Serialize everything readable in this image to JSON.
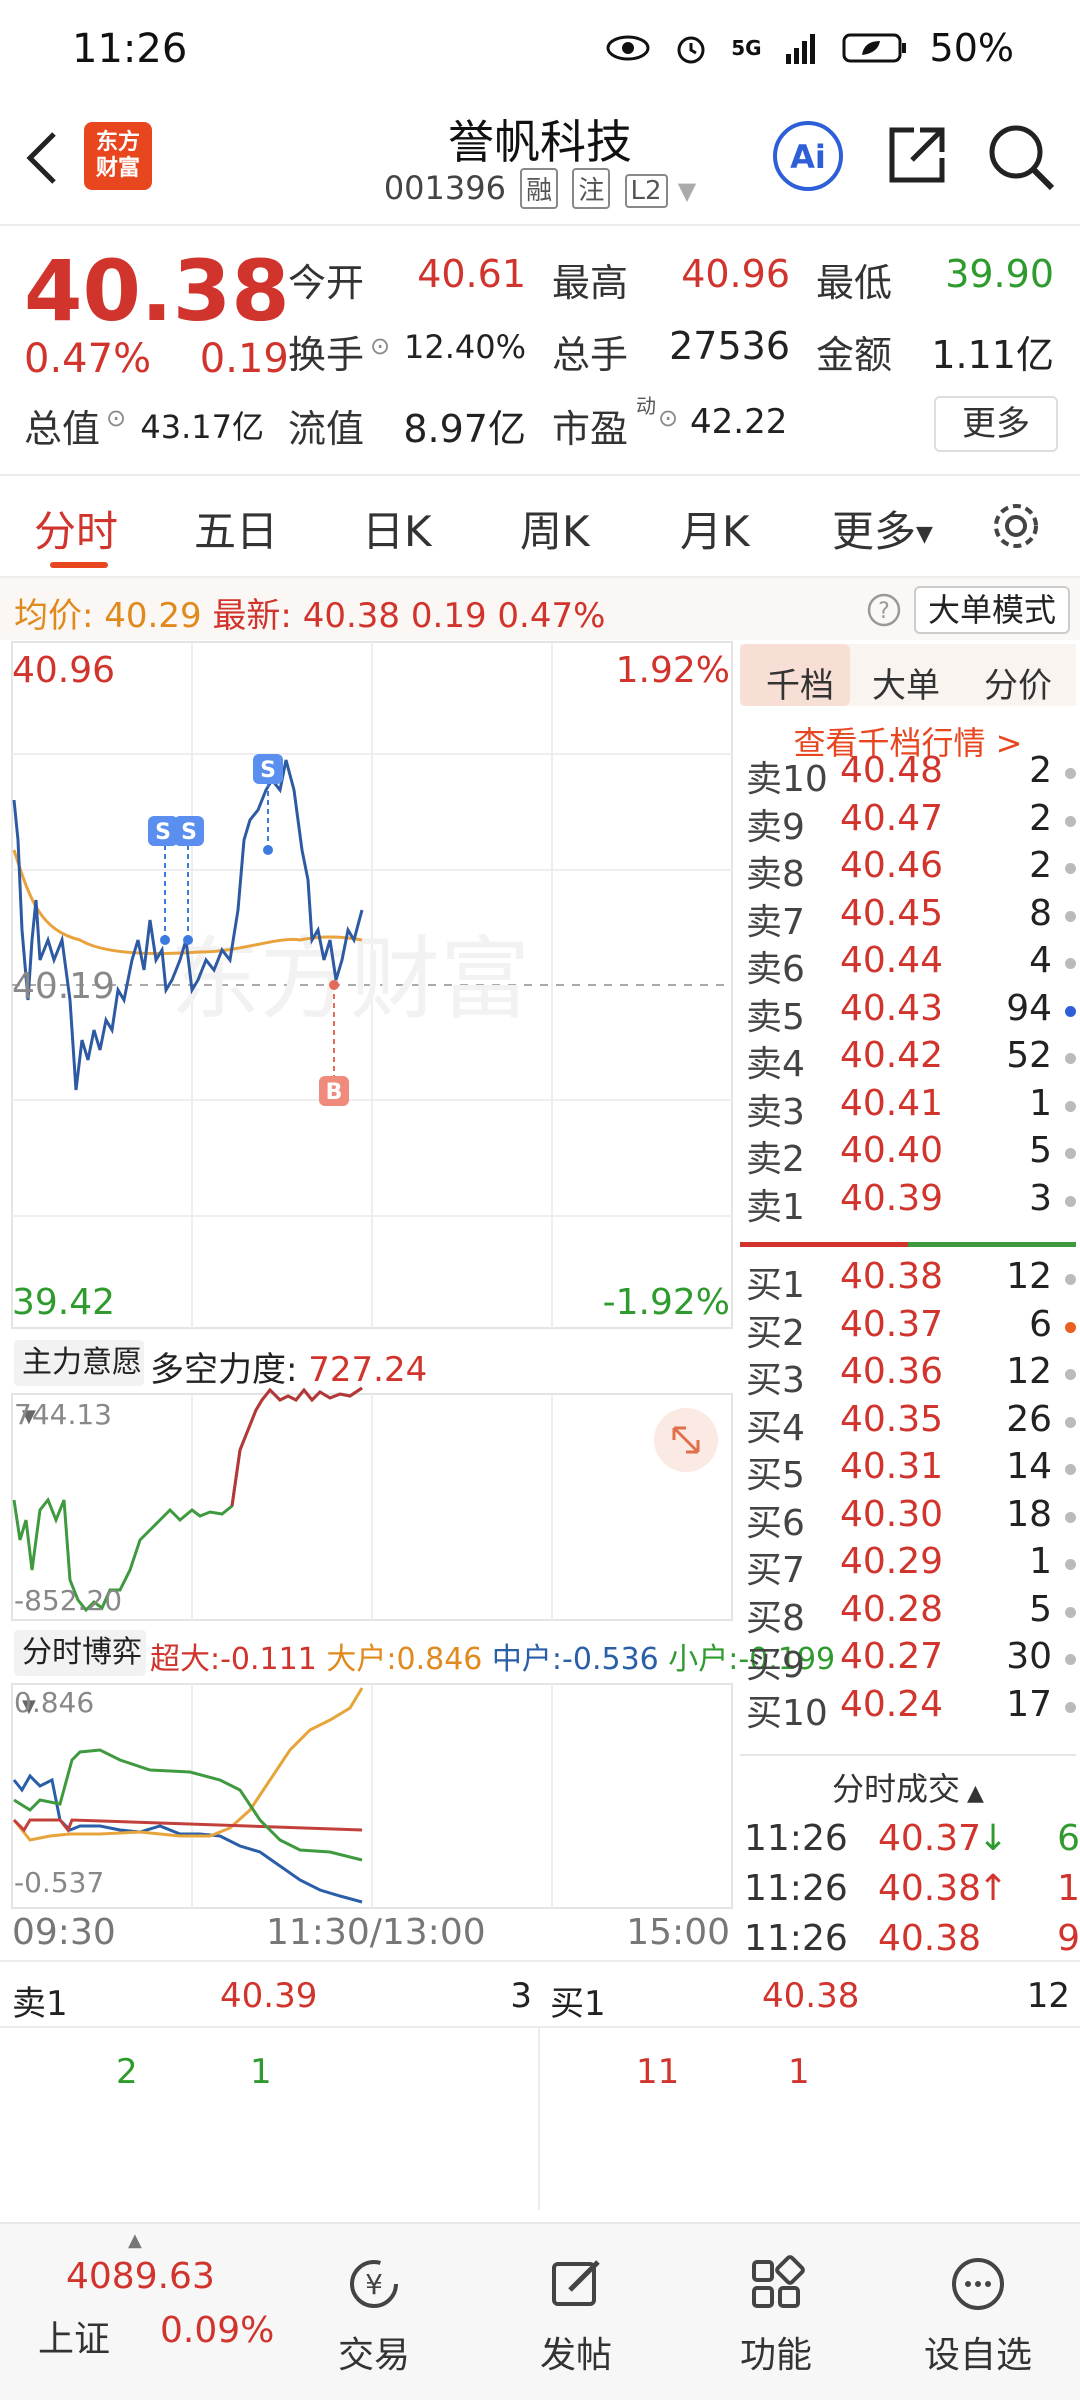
{
  "status_bar": {
    "time": "11:26",
    "network": "5G",
    "battery": "50%"
  },
  "header": {
    "logo_line1": "东方",
    "logo_line2": "财富",
    "name": "誉帆科技",
    "code": "001396",
    "tags": [
      "融",
      "注",
      "L2"
    ]
  },
  "quote": {
    "price": "40.38",
    "pct": "0.47%",
    "chg": "0.19",
    "fields": [
      {
        "label": "今开",
        "value": "40.61",
        "color": "red"
      },
      {
        "label": "最高",
        "value": "40.96",
        "color": "red"
      },
      {
        "label": "最低",
        "value": "39.90",
        "color": "green"
      },
      {
        "label": "换手",
        "value": "12.40%",
        "color": "dark"
      },
      {
        "label": "总手",
        "value": "27536",
        "color": "dark"
      },
      {
        "label": "金额",
        "value": "1.11亿",
        "color": "dark"
      },
      {
        "label": "总值",
        "value": "43.17亿",
        "color": "dark"
      },
      {
        "label": "流值",
        "value": "8.97亿",
        "color": "dark"
      },
      {
        "label": "市盈",
        "value": "42.22",
        "color": "dark"
      }
    ],
    "pe_superscript": "动",
    "more_button": "更多"
  },
  "tabs": [
    "分时",
    "五日",
    "日K",
    "周K",
    "月K",
    "更多"
  ],
  "avg_bar": {
    "avg_label": "均价:",
    "avg_value": "40.29",
    "last_label": "最新:",
    "last_value": "40.38",
    "last_chg": "0.19",
    "last_pct": "0.47%",
    "big_order_button": "大单模式"
  },
  "main_chart": {
    "high": "40.96",
    "high_pct": "1.92%",
    "low": "39.42",
    "low_pct": "-1.92%",
    "prev_close": "40.19",
    "markers": [
      "S",
      "S",
      "S",
      "B"
    ]
  },
  "chart_data": [
    {
      "type": "line",
      "x": [
        "09:30",
        "11:30/13:00",
        "15:00"
      ],
      "ylim": [
        39.42,
        40.96
      ],
      "series": []
    },
    {
      "type": "line",
      "ylim": [
        -852.2,
        744.13
      ],
      "series": []
    },
    {
      "type": "line",
      "ylim": [
        -0.537,
        0.846
      ],
      "series": [
        {
          "name": "超大",
          "values": [
            -0.111
          ]
        },
        {
          "name": "大户",
          "values": [
            0.846
          ]
        },
        {
          "name": "中户",
          "values": [
            -0.536
          ]
        },
        {
          "name": "小户",
          "values": [
            -0.199
          ]
        }
      ]
    }
  ],
  "indicator1": {
    "selector": "主力意愿",
    "title": "多空力度:",
    "value": "727.24",
    "top": "744.13",
    "bottom": "-852.20"
  },
  "indicator2": {
    "selector": "分时博弈",
    "items": [
      {
        "label": "超大:",
        "value": "-0.111",
        "color": "#d0342c"
      },
      {
        "label": "大户:",
        "value": "0.846",
        "color": "#e08a1d"
      },
      {
        "label": "中户:",
        "value": "-0.536",
        "color": "#2a5fa8"
      },
      {
        "label": "小户:",
        "value": "-0.199",
        "color": "#2f9b2f"
      }
    ],
    "top": "0.846",
    "bottom": "-0.537"
  },
  "time_axis": [
    "09:30",
    "11:30/13:00",
    "15:00"
  ],
  "book": {
    "tabs": [
      "千档",
      "大单",
      "分价"
    ],
    "link": "查看千档行情 >",
    "asks": [
      {
        "side": "卖10",
        "price": "40.48",
        "vol": "2"
      },
      {
        "side": "卖9",
        "price": "40.47",
        "vol": "2"
      },
      {
        "side": "卖8",
        "price": "40.46",
        "vol": "2"
      },
      {
        "side": "卖7",
        "price": "40.45",
        "vol": "8"
      },
      {
        "side": "卖6",
        "price": "40.44",
        "vol": "4"
      },
      {
        "side": "卖5",
        "price": "40.43",
        "vol": "94"
      },
      {
        "side": "卖4",
        "price": "40.42",
        "vol": "52"
      },
      {
        "side": "卖3",
        "price": "40.41",
        "vol": "1"
      },
      {
        "side": "卖2",
        "price": "40.40",
        "vol": "5"
      },
      {
        "side": "卖1",
        "price": "40.39",
        "vol": "3"
      }
    ],
    "bids": [
      {
        "side": "买1",
        "price": "40.38",
        "vol": "12"
      },
      {
        "side": "买2",
        "price": "40.37",
        "vol": "6"
      },
      {
        "side": "买3",
        "price": "40.36",
        "vol": "12"
      },
      {
        "side": "买4",
        "price": "40.35",
        "vol": "26"
      },
      {
        "side": "买5",
        "price": "40.31",
        "vol": "14"
      },
      {
        "side": "买6",
        "price": "40.30",
        "vol": "18"
      },
      {
        "side": "买7",
        "price": "40.29",
        "vol": "1"
      },
      {
        "side": "买8",
        "price": "40.28",
        "vol": "5"
      },
      {
        "side": "买9",
        "price": "40.27",
        "vol": "30"
      },
      {
        "side": "买10",
        "price": "40.24",
        "vol": "17"
      }
    ],
    "tick_title": "分时成交",
    "ticks": [
      {
        "time": "11:26",
        "price": "40.37",
        "arrow": "↓",
        "vol": "6"
      },
      {
        "time": "11:26",
        "price": "40.38",
        "arrow": "↑",
        "vol": "1"
      },
      {
        "time": "11:26",
        "price": "40.38",
        "arrow": "",
        "vol": "9"
      }
    ]
  },
  "detail": {
    "ask_label": "卖1",
    "ask_price": "40.39",
    "ask_vol": "3",
    "bid_label": "买1",
    "bid_price": "40.38",
    "bid_vol": "12",
    "ask_queue": [
      "2",
      "1"
    ],
    "bid_queue": [
      "11",
      "1"
    ]
  },
  "footer": {
    "index_value": "4089.63",
    "index_name": "上证",
    "index_pct": "0.09%",
    "items": [
      "交易",
      "发帖",
      "功能",
      "设自选"
    ]
  },
  "watermark": "东方财富"
}
